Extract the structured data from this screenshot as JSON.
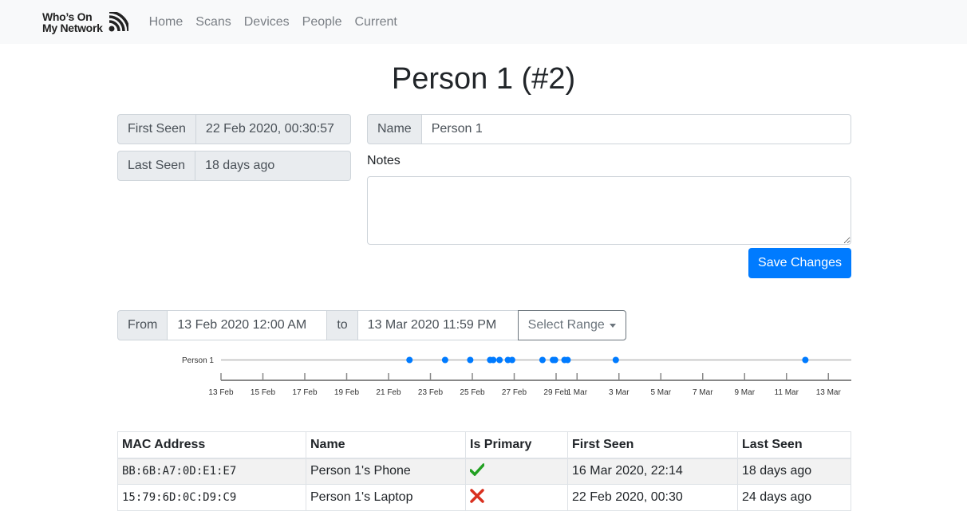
{
  "nav": {
    "brand_line1": "Who’s On",
    "brand_line2": "My Network",
    "links": [
      "Home",
      "Scans",
      "Devices",
      "People",
      "Current"
    ]
  },
  "page_title": "Person 1 (#2)",
  "info": {
    "first_seen_label": "First Seen",
    "first_seen_value": "22 Feb 2020, 00:30:57",
    "last_seen_label": "Last Seen",
    "last_seen_value": "18 days ago"
  },
  "form": {
    "name_label": "Name",
    "name_value": "Person 1",
    "notes_label": "Notes",
    "notes_value": "",
    "save_label": "Save Changes"
  },
  "range": {
    "from_label": "From",
    "from_value": "13 Feb 2020 12:00 AM",
    "to_label": "to",
    "to_value": "13 Mar 2020 11:59 PM",
    "select_label": "Select Range"
  },
  "chart_data": {
    "type": "scatter",
    "series_label": "Person 1",
    "x_range_days": [
      0,
      30
    ],
    "x_start": "13 Feb 2020",
    "tick_labels": [
      "13 Feb",
      "15 Feb",
      "17 Feb",
      "19 Feb",
      "21 Feb",
      "23 Feb",
      "25 Feb",
      "27 Feb",
      "29 Feb",
      "1 Mar",
      "3 Mar",
      "5 Mar",
      "7 Mar",
      "9 Mar",
      "11 Mar",
      "13 Mar"
    ],
    "tick_days": [
      0,
      2,
      4,
      6,
      8,
      10,
      12,
      14,
      16,
      17,
      19,
      21,
      23,
      25,
      27,
      29
    ],
    "point_days": [
      9.0,
      10.7,
      11.9,
      12.85,
      13.0,
      13.3,
      13.7,
      13.9,
      15.35,
      15.85,
      15.95,
      16.4,
      16.55,
      18.85,
      27.9
    ],
    "colors": {
      "point": "#007bff",
      "line": "#bbbbbb",
      "axis": "#888888"
    }
  },
  "table": {
    "headers": [
      "MAC Address",
      "Name",
      "Is Primary",
      "First Seen",
      "Last Seen"
    ],
    "rows": [
      {
        "mac": "BB:6B:A7:0D:E1:E7",
        "name": "Person 1's Phone",
        "primary": "check-icon",
        "first_seen": "16 Mar 2020, 22:14",
        "last_seen": "18 days ago"
      },
      {
        "mac": "15:79:6D:0C:D9:C9",
        "name": "Person 1's Laptop",
        "primary": "cross-icon",
        "first_seen": "22 Feb 2020, 00:30",
        "last_seen": "24 days ago"
      }
    ]
  }
}
